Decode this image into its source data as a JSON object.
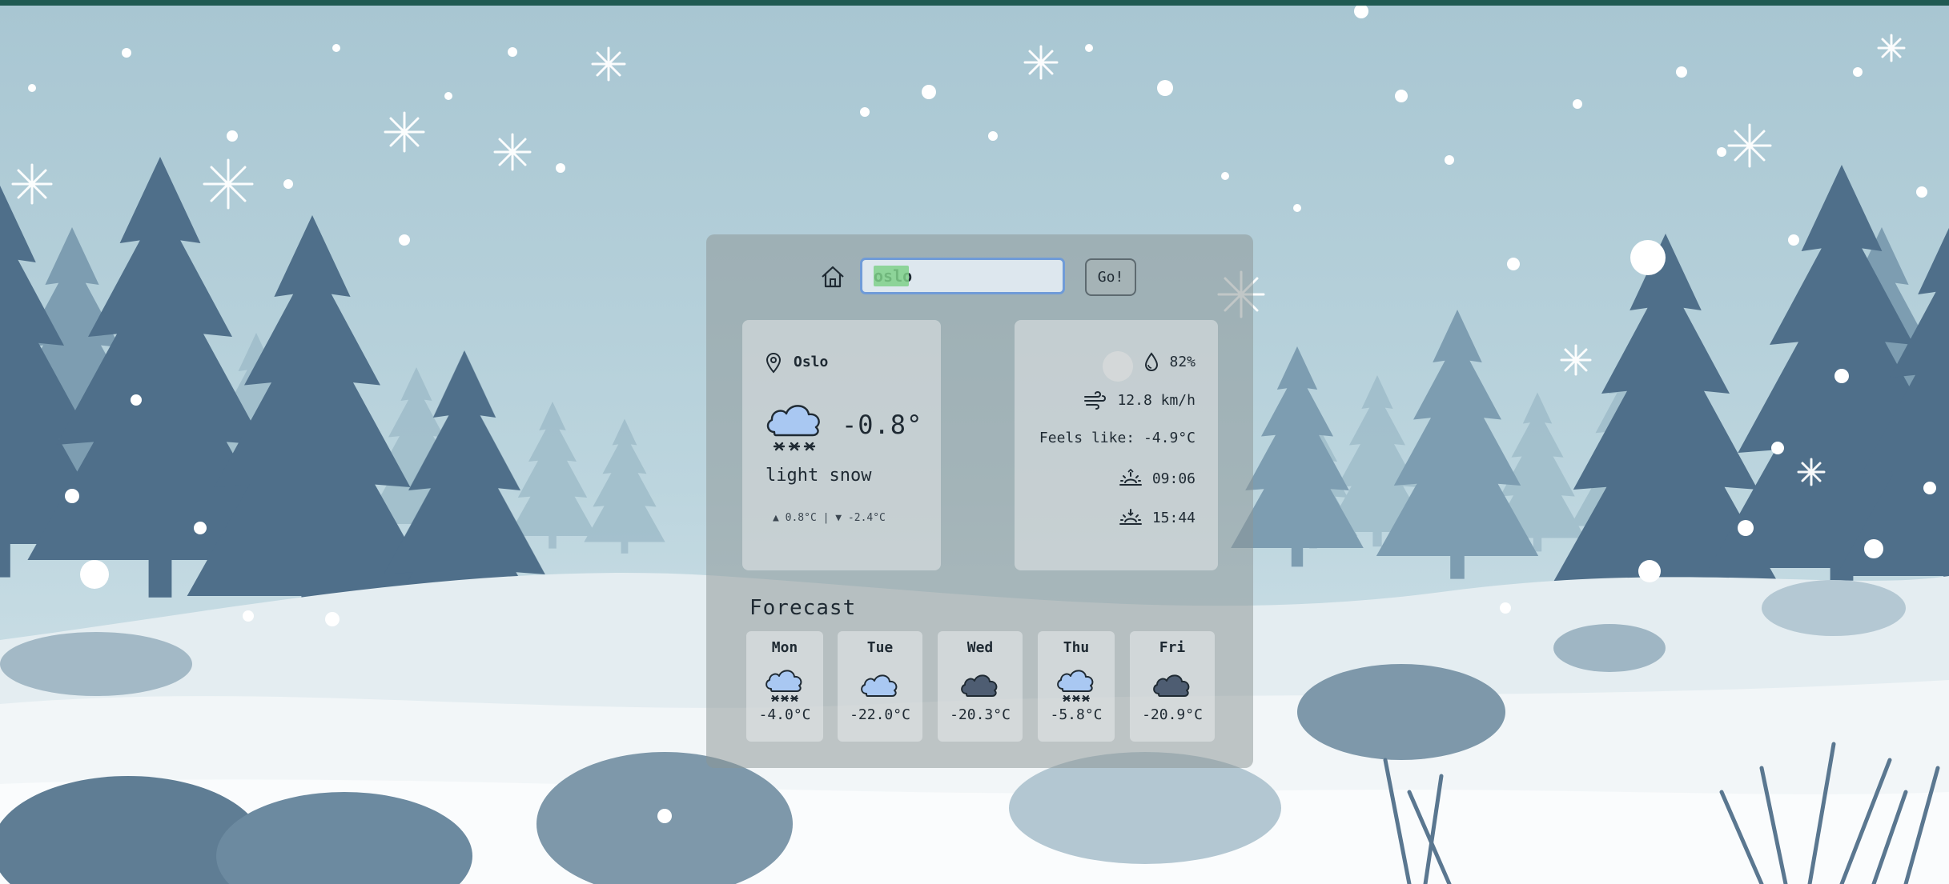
{
  "search": {
    "value": "oslo",
    "go_label": "Go!"
  },
  "current": {
    "city": "Oslo",
    "icon": "cloud-snow-icon",
    "temperature": "-0.8°",
    "description": "light snow",
    "high_low": "▲ 0.8°C | ▼ -2.4°C"
  },
  "details": {
    "humidity": "82%",
    "wind": "12.8 km/h",
    "feels_like": "Feels like: -4.9°C",
    "sunrise": "09:06",
    "sunset": "15:44"
  },
  "forecast": {
    "title": "Forecast",
    "days": [
      {
        "day": "Mon",
        "temp": "-4.0°C",
        "icon": "cloud-snow-icon"
      },
      {
        "day": "Tue",
        "temp": "-22.0°C",
        "icon": "cloud-icon"
      },
      {
        "day": "Wed",
        "temp": "-20.3°C",
        "icon": "dark-cloud-icon"
      },
      {
        "day": "Thu",
        "temp": "-5.8°C",
        "icon": "cloud-snow-icon"
      },
      {
        "day": "Fri",
        "temp": "-20.9°C",
        "icon": "dark-cloud-icon"
      }
    ]
  },
  "colors": {
    "accent_input_border": "#6f9bd8",
    "light_cloud": "#a9c8f2",
    "dark_cloud": "#4e5d72",
    "top_bar": "#1f5a52"
  }
}
